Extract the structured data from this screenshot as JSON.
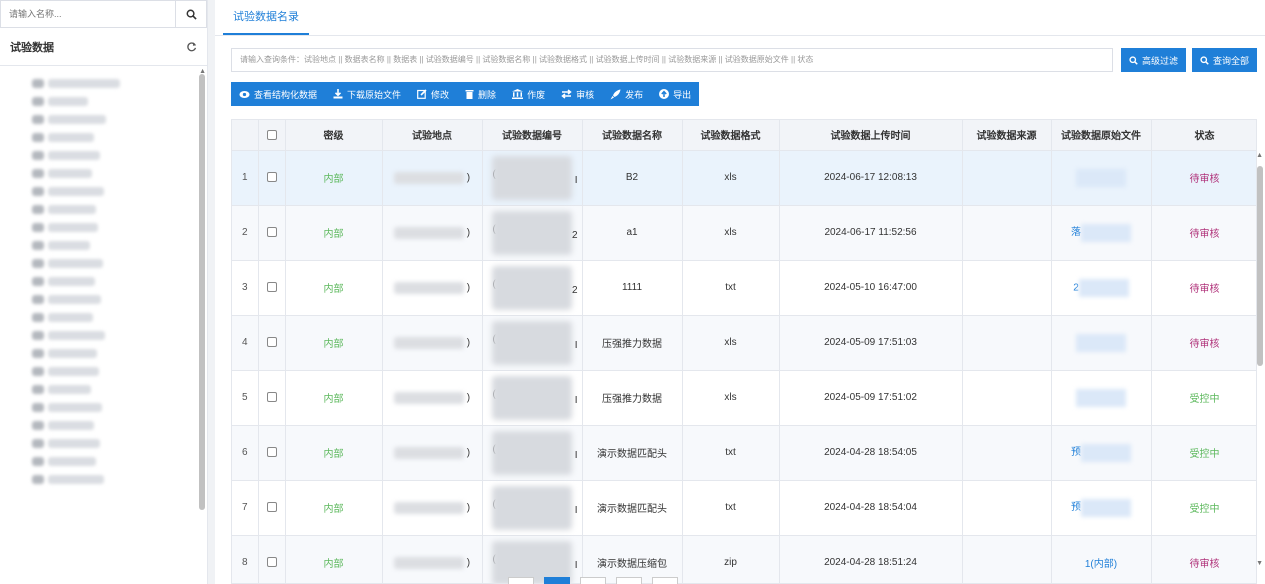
{
  "sidebar": {
    "search_placeholder": "请输入名称...",
    "tree_title": "试验数据"
  },
  "tabs": [
    {
      "label": "试验数据名录"
    }
  ],
  "query": {
    "placeholder": "请输入查询条件：试验地点 || 数据表名称 || 数据表 || 试验数据编号 || 试验数据名称 || 试验数据格式 || 试验数据上传时间 || 试验数据来源 || 试验数据原始文件 || 状态",
    "advanced_filter": "高级过滤",
    "query_all": "查询全部"
  },
  "toolbar": {
    "view_structured": "查看结构化数据",
    "download_raw": "下载原始文件",
    "edit": "修改",
    "delete": "删除",
    "void": "作废",
    "audit": "审核",
    "publish": "发布",
    "export": "导出"
  },
  "table": {
    "headers": [
      "密级",
      "试验地点",
      "试验数据编号",
      "试验数据名称",
      "试验数据格式",
      "试验数据上传时间",
      "试验数据来源",
      "试验数据原始文件",
      "状态"
    ],
    "rows": [
      {
        "num": "1",
        "level": "内部",
        "location_tail": ")",
        "code_head": "(",
        "code_tail": "I",
        "name": "B2",
        "format": "xls",
        "time": "2024-06-17 12:08:13",
        "file_prefix": "",
        "status": "待审核"
      },
      {
        "num": "2",
        "level": "内部",
        "location_tail": ")",
        "code_head": "(",
        "code_tail": "2",
        "name": "a1",
        "format": "xls",
        "time": "2024-06-17 11:52:56",
        "file_prefix": "落",
        "status": "待审核"
      },
      {
        "num": "3",
        "level": "内部",
        "location_tail": ")",
        "code_head": "(",
        "code_tail": "2",
        "name": "1111",
        "format": "txt",
        "time": "2024-05-10 16:47:00",
        "file_prefix": "2",
        "status": "待审核"
      },
      {
        "num": "4",
        "level": "内部",
        "location_tail": ")",
        "code_head": "(",
        "code_tail": "I",
        "name": "压强推力数据",
        "format": "xls",
        "time": "2024-05-09 17:51:03",
        "file_prefix": "",
        "status": "待审核"
      },
      {
        "num": "5",
        "level": "内部",
        "location_tail": ")",
        "code_head": "(",
        "code_tail": "I",
        "name": "压强推力数据",
        "format": "xls",
        "time": "2024-05-09 17:51:02",
        "file_prefix": "",
        "status": "受控中"
      },
      {
        "num": "6",
        "level": "内部",
        "location_tail": ")",
        "code_head": "(",
        "code_tail": "I",
        "name": "演示数据匹配头",
        "format": "txt",
        "time": "2024-04-28 18:54:05",
        "file_prefix": "预",
        "status": "受控中"
      },
      {
        "num": "7",
        "level": "内部",
        "location_tail": ")",
        "code_head": "(",
        "code_tail": "I",
        "name": "演示数据匹配头",
        "format": "txt",
        "time": "2024-04-28 18:54:04",
        "file_prefix": "预",
        "status": "受控中"
      },
      {
        "num": "8",
        "level": "内部",
        "location_tail": ")",
        "code_head": "(",
        "code_tail": "I",
        "name": "演示数据压缩包",
        "format": "zip",
        "time": "2024-04-28 18:51:24",
        "file_prefix": "1(内部)",
        "status": "待审核"
      }
    ]
  },
  "colors": {
    "accent": "#1f7fd8",
    "pending": "#b0327a",
    "controlled": "#5cb85c"
  }
}
